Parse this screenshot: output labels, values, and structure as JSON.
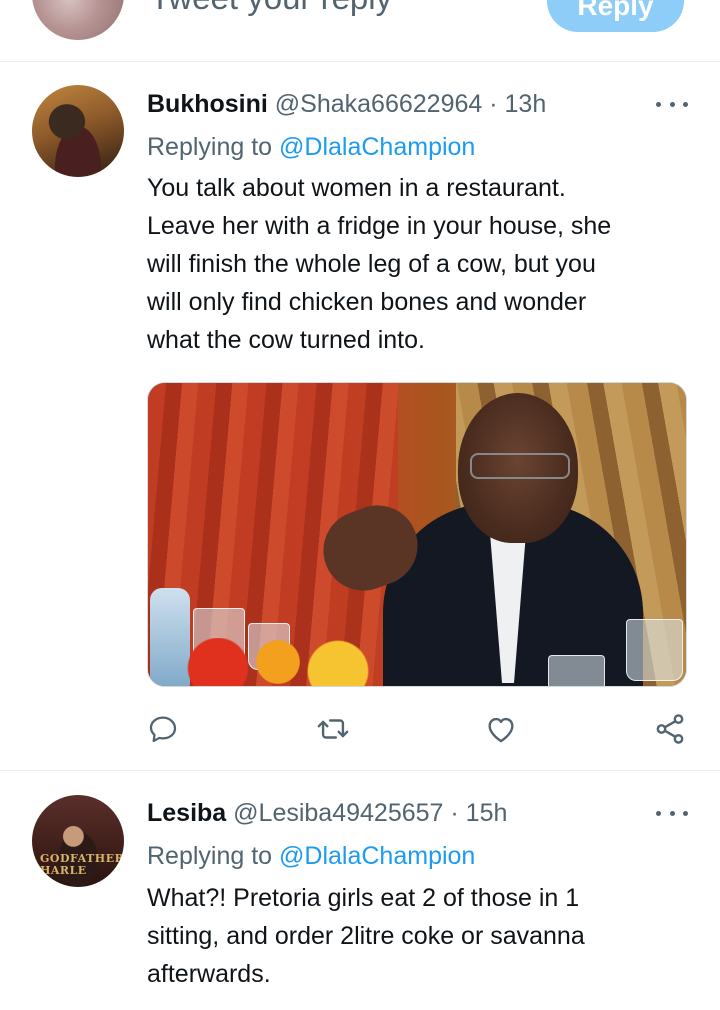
{
  "composer": {
    "placeholder": "Tweet your reply",
    "reply_label": "Reply"
  },
  "tweets": [
    {
      "name": "Bukhosini",
      "handle": "@Shaka66622964",
      "time": "13h",
      "replying_prefix": "Replying to",
      "replying_to": "@DlalaChampion",
      "lines": [
        "You talk about women in a restaurant.",
        "Leave her with a fridge in your house, she",
        "will finish the whole leg of a cow, but you",
        "will only find chicken bones and wonder",
        "what the cow turned into."
      ],
      "has_photo": true,
      "actions": [
        "reply-icon",
        "retweet-icon",
        "like-icon",
        "share-icon"
      ]
    },
    {
      "name": "Lesiba",
      "handle": "@Lesiba49425657",
      "time": "15h",
      "replying_prefix": "Replying to",
      "replying_to": "@DlalaChampion",
      "avatar_text": "GODFATHER HARLE",
      "lines": [
        "What?! Pretoria girls eat 2 of those in 1",
        "sitting, and order 2litre coke or savanna",
        "afterwards."
      ]
    }
  ],
  "colors": {
    "accent": "#1d9bf0",
    "reply_button": "#8ecdf7",
    "secondary_text": "#536471",
    "divider": "#e6ecf0"
  }
}
